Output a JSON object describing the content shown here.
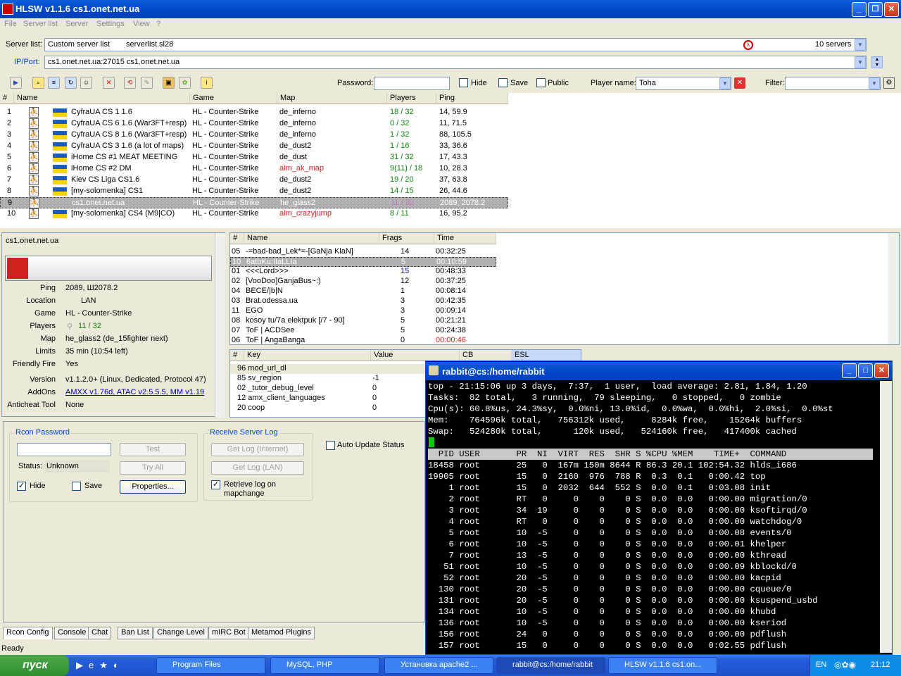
{
  "window": {
    "title": "HLSW v1.1.6   cs1.onet.net.ua"
  },
  "menu": [
    "File",
    "Server list",
    "Server",
    "Settings",
    "View",
    "?"
  ],
  "serverlist": {
    "label": "Server list:",
    "value": "Custom server list",
    "file": "serverlist.sl28",
    "count": "10 servers"
  },
  "ipport": {
    "label": "IP/Port:",
    "value": "cs1.onet.net.ua:27015 cs1.onet.net.ua"
  },
  "toolbar": {
    "password_label": "Password:",
    "hide": "Hide",
    "save": "Save",
    "public": "Public",
    "player_name_label": "Player name:",
    "player_name": "Toha",
    "filter_label": "Filter:"
  },
  "servers": {
    "headers": [
      "#",
      "Name",
      "Game",
      "Map",
      "Players",
      "Ping"
    ],
    "rows": [
      {
        "n": "1",
        "name": "CyfraUA CS 1 1.6",
        "game": "HL - Counter-Strike",
        "map": "de_inferno",
        "players": "18 / 32",
        "ping": "14, 59.9"
      },
      {
        "n": "2",
        "name": "CyfraUA CS 6 1.6 (War3FT+resp)",
        "game": "HL - Counter-Strike",
        "map": "de_inferno",
        "players": "0 / 32",
        "ping": "11, 71.5"
      },
      {
        "n": "3",
        "name": "CyfraUA CS 8 1.6 (War3FT+resp)",
        "game": "HL - Counter-Strike",
        "map": "de_inferno",
        "players": "1 / 32",
        "ping": "88, 105.5"
      },
      {
        "n": "4",
        "name": "CyfraUA CS 3 1.6 (a lot of maps)",
        "game": "HL - Counter-Strike",
        "map": "de_dust2",
        "players": "1 / 16",
        "ping": "33, 36.6"
      },
      {
        "n": "5",
        "name": "iHome CS #1 MEAT MEETING",
        "game": "HL - Counter-Strike",
        "map": "de_dust",
        "players": "31 / 32",
        "ping": "17, 43.3"
      },
      {
        "n": "6",
        "name": "iHome CS #2 DM",
        "game": "HL - Counter-Strike",
        "map": "aim_ak_map",
        "players": "9(11) / 18",
        "ping": "10, 28.3"
      },
      {
        "n": "7",
        "name": "Kiev CS Liga CS1.6",
        "game": "HL - Counter-Strike",
        "map": "de_dust2",
        "players": "19 / 20",
        "ping": "37, 63.8"
      },
      {
        "n": "8",
        "name": "[my-solomenka] CS1",
        "game": "HL - Counter-Strike",
        "map": "de_dust2",
        "players": "14 / 15",
        "ping": "26, 44.6"
      },
      {
        "n": "9",
        "name": "cs1.onet.net.ua",
        "game": "HL - Counter-Strike",
        "map": "he_glass2",
        "players": "11 / 32",
        "ping": "2089, 2078.2"
      },
      {
        "n": "10",
        "name": "[my-solomenka] CS4 (M9|CO)",
        "game": "HL - Counter-Strike",
        "map": "aim_crazyjump",
        "players": "8 / 11",
        "ping": "16, 95.2"
      }
    ]
  },
  "info": {
    "server": "cs1.onet.net.ua",
    "fields": [
      {
        "k": "Ping",
        "v": "2089, Ш2078.2"
      },
      {
        "k": "Location",
        "v": "LAN"
      },
      {
        "k": "Game",
        "v": "HL - Counter-Strike"
      },
      {
        "k": "Players",
        "v": "11 / 32"
      },
      {
        "k": "Map",
        "v": "he_glass2 (de_15fighter next)"
      },
      {
        "k": "Limits",
        "v": "35 min (10:54 left)"
      },
      {
        "k": "Friendly Fire",
        "v": "Yes"
      },
      {
        "k": "Version",
        "v": "v1.1.2.0+ (Linux, Dedicated, Protocol 47)"
      },
      {
        "k": "AddOns",
        "v": "AMXX v1.76d, ATAC v2.5.5.5, MM v1.19"
      },
      {
        "k": "Anticheat Tool",
        "v": "None"
      }
    ]
  },
  "players": {
    "headers": [
      "#",
      "Name",
      "Frags",
      "Time"
    ],
    "rows": [
      {
        "n": "05",
        "name": "-=bad-bad_Lek*=-[GaNja KlaN]",
        "frags": "14",
        "time": "00:32:25"
      },
      {
        "n": "10",
        "name": "6atbKu:IIaLLIa",
        "frags": "5",
        "time": "00:10:59"
      },
      {
        "n": "01",
        "name": "<<<Lord>>>",
        "frags": "15",
        "time": "00:48:33"
      },
      {
        "n": "02",
        "name": "[VooDoo]GanjaBus~:)",
        "frags": "12",
        "time": "00:37:25"
      },
      {
        "n": "04",
        "name": "BECE/|b|N",
        "frags": "1",
        "time": "00:08:14"
      },
      {
        "n": "03",
        "name": "Brat.odessa.ua",
        "frags": "3",
        "time": "00:42:35"
      },
      {
        "n": "11",
        "name": "EGO",
        "frags": "3",
        "time": "00:09:14"
      },
      {
        "n": "08",
        "name": "kosoy tu/7a elektpuk [/7 - 90]",
        "frags": "5",
        "time": "00:21:21"
      },
      {
        "n": "07",
        "name": "ToF | ACDSee",
        "frags": "5",
        "time": "00:24:38"
      },
      {
        "n": "06",
        "name": "ToF | AngaBanga",
        "frags": "0",
        "time": "00:00:46"
      }
    ]
  },
  "rules": {
    "headers": [
      "#",
      "Key",
      "Value",
      "CB",
      "ESL"
    ],
    "rows": [
      {
        "k": "96  mod_url_dl",
        "v": ""
      },
      {
        "k": "85  sv_region",
        "v": "-1"
      },
      {
        "k": "02  _tutor_debug_level",
        "v": "0"
      },
      {
        "k": "12  amx_client_languages",
        "v": "0"
      },
      {
        "k": "20  coop",
        "v": "0"
      }
    ]
  },
  "rcon": {
    "group": "Rcon Password",
    "test": "Test",
    "status_label": "Status:",
    "status": "Unknown",
    "try_all": "Try All",
    "hide": "Hide",
    "save": "Save",
    "properties": "Properties..."
  },
  "log": {
    "group": "Receive Server Log",
    "internet": "Get Log (Internet)",
    "lan": "Get Log (LAN)",
    "retrieve": "Retrieve log on mapchange",
    "auto": "Auto Update Status"
  },
  "tabs": [
    "Rcon Config",
    "Console",
    "Chat",
    "Ban List",
    "Change Level",
    "mIRC Bot",
    "Metamod Plugins"
  ],
  "status": "Ready",
  "terminal": {
    "title": "rabbit@cs:/home/rabbit",
    "lines": [
      "top - 21:15:06 up 3 days,  7:37,  1 user,  load average: 2.81, 1.84, 1.20",
      "Tasks:  82 total,   3 running,  79 sleeping,   0 stopped,   0 zombie",
      "Cpu(s): 60.8%us, 24.3%sy,  0.0%ni, 13.0%id,  0.0%wa,  0.0%hi,  2.0%si,  0.0%st",
      "Mem:    764596k total,   756312k used,     8284k free,    15264k buffers",
      "Swap:   524280k total,      120k used,   524160k free,   417400k cached"
    ],
    "header": "  PID USER       PR  NI  VIRT  RES  SHR S %CPU %MEM    TIME+  COMMAND",
    "procs": [
      "18458 root       25   0  167m 150m 8644 R 86.3 20.1 102:54.32 hlds_i686",
      "19905 root       15   0  2160  976  788 R  0.3  0.1   0:00.42 top",
      "    1 root       15   0  2032  644  552 S  0.0  0.1   0:03.08 init",
      "    2 root       RT   0     0    0    0 S  0.0  0.0   0:00.00 migration/0",
      "    3 root       34  19     0    0    0 S  0.0  0.0   0:00.00 ksoftirqd/0",
      "    4 root       RT   0     0    0    0 S  0.0  0.0   0:00.00 watchdog/0",
      "    5 root       10  -5     0    0    0 S  0.0  0.0   0:00.08 events/0",
      "    6 root       10  -5     0    0    0 S  0.0  0.0   0:00.01 khelper",
      "    7 root       13  -5     0    0    0 S  0.0  0.0   0:00.00 kthread",
      "   51 root       10  -5     0    0    0 S  0.0  0.0   0:00.09 kblockd/0",
      "   52 root       20  -5     0    0    0 S  0.0  0.0   0:00.00 kacpid",
      "  130 root       20  -5     0    0    0 S  0.0  0.0   0:00.00 cqueue/0",
      "  131 root       20  -5     0    0    0 S  0.0  0.0   0:00.00 ksuspend_usbd",
      "  134 root       10  -5     0    0    0 S  0.0  0.0   0:00.00 khubd",
      "  136 root       10  -5     0    0    0 S  0.0  0.0   0:00.00 kseriod",
      "  156 root       24   0     0    0    0 S  0.0  0.0   0:00.00 pdflush",
      "  157 root       15   0     0    0    0 S  0.0  0.0   0:02.55 pdflush"
    ]
  },
  "taskbar": {
    "start": "пуск",
    "items": [
      "Program Files",
      "MySQL, PHP",
      "Установка apache2 ...",
      "rabbit@cs:/home/rabbit",
      "HLSW v1.1.6   cs1.on..."
    ],
    "lang": "EN",
    "clock": "21:12"
  }
}
